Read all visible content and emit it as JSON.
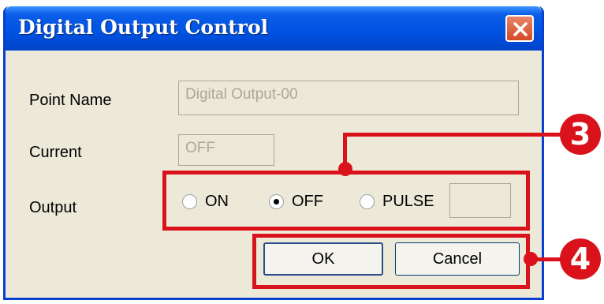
{
  "window": {
    "title": "Digital Output Control",
    "close_icon": "close-icon"
  },
  "form": {
    "point_name_label": "Point Name",
    "point_name_value": "Digital Output-00",
    "current_label": "Current",
    "current_value": "OFF",
    "output_label": "Output",
    "options": [
      {
        "label": "ON",
        "selected": false
      },
      {
        "label": "OFF",
        "selected": true
      },
      {
        "label": "PULSE",
        "selected": false
      }
    ],
    "pulse_value": ""
  },
  "buttons": {
    "ok_label": "OK",
    "cancel_label": "Cancel"
  },
  "callouts": {
    "output_callout": "3",
    "buttons_callout": "4",
    "color": "#d9121b"
  }
}
